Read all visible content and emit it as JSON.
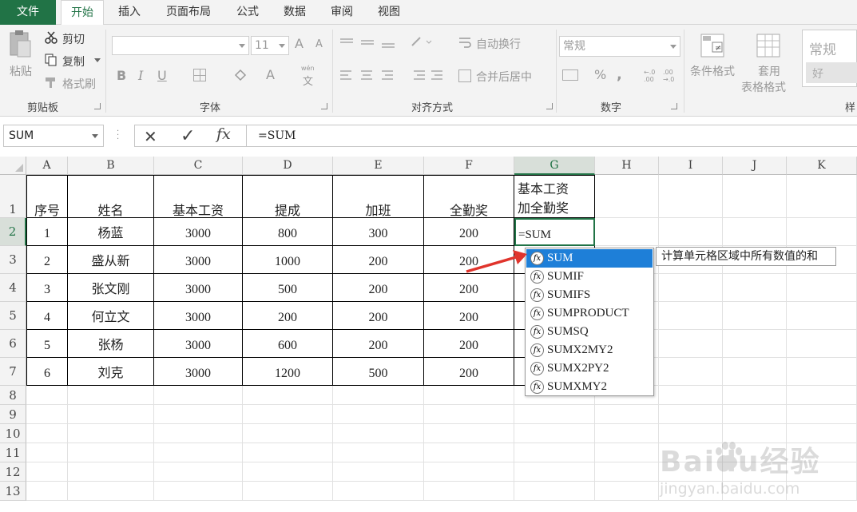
{
  "tabs": [
    "文件",
    "开始",
    "插入",
    "页面布局",
    "公式",
    "数据",
    "审阅",
    "视图"
  ],
  "ribbon": {
    "clipboard": {
      "paste": "粘贴",
      "cut": "剪切",
      "copy": "复制",
      "painter": "格式刷",
      "label": "剪贴板"
    },
    "font": {
      "size": "11",
      "label": "字体",
      "bold": "B",
      "italic": "I",
      "underline": "U",
      "grow": "A",
      "shrink": "A",
      "color": "A",
      "phonetic": "wén",
      "phonetic2": "文"
    },
    "align": {
      "wrap": "自动换行",
      "merge": "合并后居中",
      "label": "对齐方式"
    },
    "number": {
      "format": "常规",
      "percent": "%",
      "comma": ",",
      "label": "数字"
    },
    "styles": {
      "cond": "条件格式",
      "table1": "套用",
      "table2": "表格格式",
      "normal": "常规",
      "good": "好",
      "label": "样"
    }
  },
  "formula_bar": {
    "name_box": "SUM",
    "cancel": "✕",
    "enter": "✓",
    "fx": "fx",
    "content": "=SUM"
  },
  "columns": [
    "A",
    "B",
    "C",
    "D",
    "E",
    "F",
    "G",
    "H",
    "I",
    "J",
    "K"
  ],
  "rows": [
    "1",
    "2",
    "3",
    "4",
    "5",
    "6",
    "7",
    "8",
    "9",
    "10",
    "11",
    "12",
    "13"
  ],
  "table": {
    "headers": [
      "序号",
      "姓名",
      "基本工资",
      "提成",
      "加班",
      "全勤奖"
    ],
    "g_header_line1": "基本工资",
    "g_header_line2": "加全勤奖",
    "data": [
      [
        "1",
        "杨蓝",
        "3000",
        "800",
        "300",
        "200"
      ],
      [
        "2",
        "盛从新",
        "3000",
        "1000",
        "200",
        "200"
      ],
      [
        "3",
        "张文刚",
        "3000",
        "500",
        "200",
        "200"
      ],
      [
        "4",
        "何立文",
        "3000",
        "200",
        "200",
        "200"
      ],
      [
        "5",
        "张杨",
        "3000",
        "600",
        "200",
        "200"
      ],
      [
        "6",
        "刘克",
        "3000",
        "1200",
        "500",
        "200"
      ]
    ],
    "editing_cell": "=SUM"
  },
  "autocomplete": {
    "items": [
      "SUM",
      "SUMIF",
      "SUMIFS",
      "SUMPRODUCT",
      "SUMSQ",
      "SUMX2MY2",
      "SUMX2PY2",
      "SUMXMY2"
    ],
    "selected_index": 0,
    "icon_glyph": "fx",
    "tooltip": "计算单元格区域中所有数值的和"
  },
  "watermark": {
    "text": "Baidu经验",
    "url": "jingyan.baidu.com"
  },
  "colors": {
    "excel_green": "#217346",
    "selection_blue": "#1e7fd8",
    "arrow_red": "#e0342c"
  }
}
